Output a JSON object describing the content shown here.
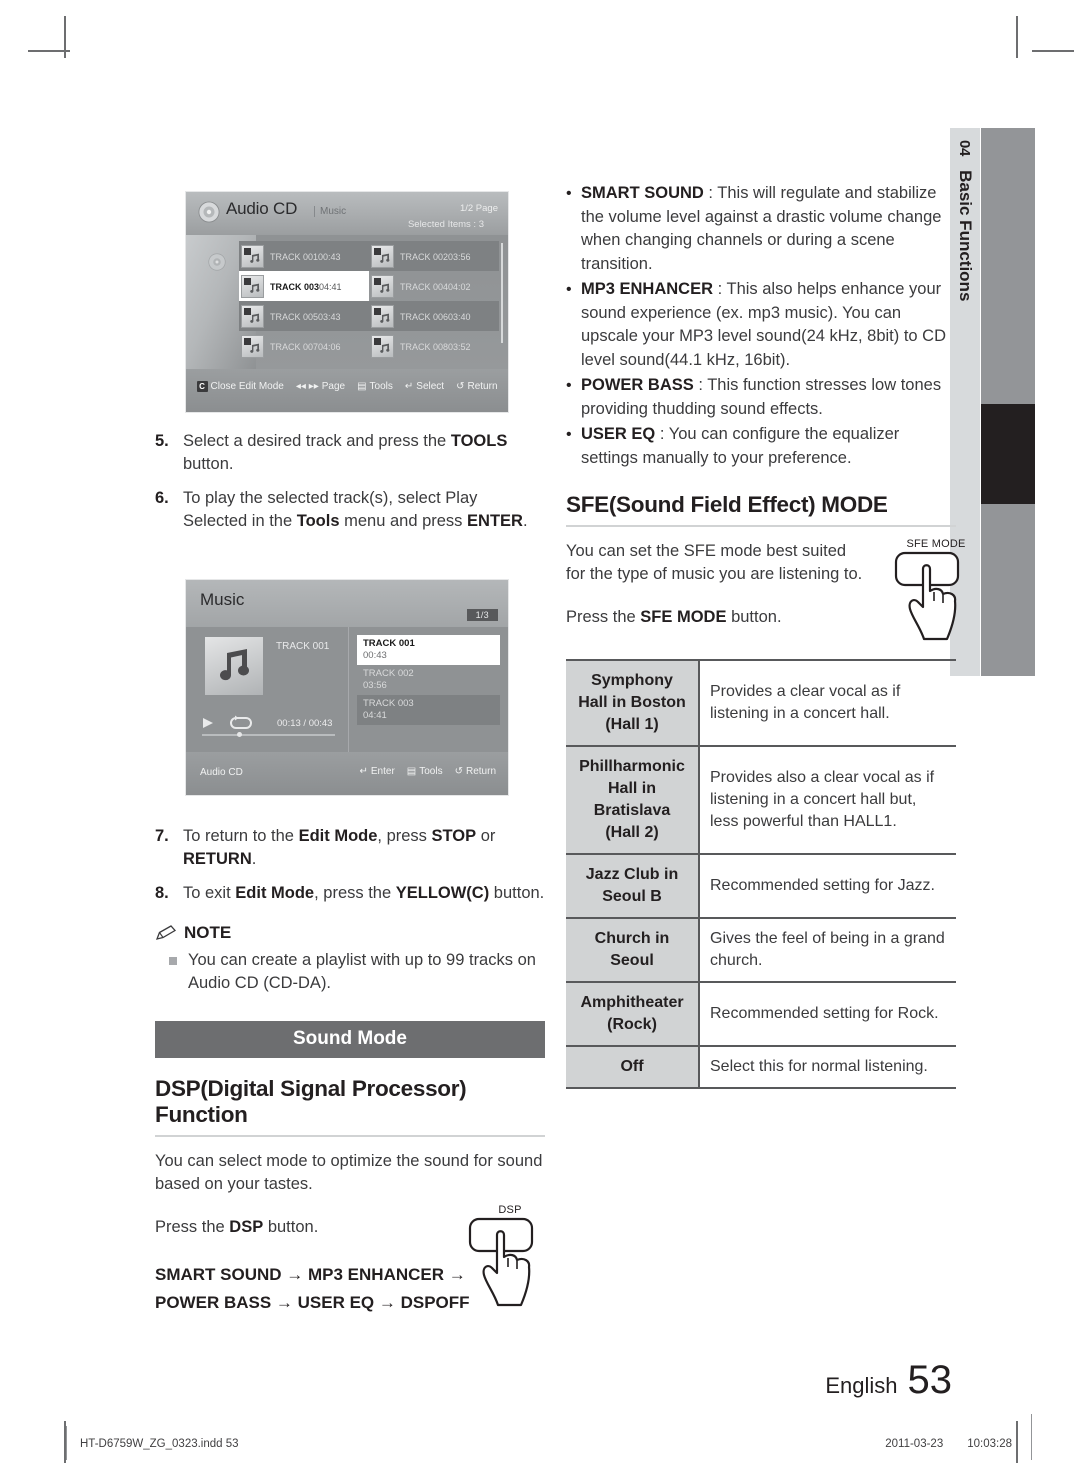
{
  "side_tab": {
    "number": "04",
    "title": "Basic Functions"
  },
  "left_column": {
    "steps": [
      {
        "n": "5.",
        "html": "Select a desired track and press the <b>TOOLS</b> button."
      },
      {
        "n": "6.",
        "html": "To play the selected track(s), select Play Selected in the <b>Tools</b> menu and press <b>ENTER</b>."
      },
      {
        "n": "7.",
        "html": "To return to the <b>Edit Mode</b>, press <b>STOP</b> or <b>RETURN</b>."
      },
      {
        "n": "8.",
        "html": "To exit <b>Edit Mode</b>, press the <b>YELLOW(C)</b> button."
      }
    ],
    "note": {
      "label": "NOTE",
      "items": [
        "You can create a playlist with up to 99 tracks on Audio CD (CD-DA)."
      ]
    },
    "banner": "Sound Mode",
    "dsp": {
      "heading": "DSP(Digital Signal Processor) Function",
      "paragraph": "You can select mode to optimize the sound for sound based on your tastes.",
      "press_html": "Press the <b>DSP</b> button.",
      "chain_line1": "SMART SOUND → MP3 ENHANCER →",
      "chain_line2": "POWER BASS →  USER EQ → DSPOFF",
      "button_caption": "DSP"
    }
  },
  "right_column": {
    "bullets": [
      {
        "html": "<b>SMART SOUND</b> : This will regulate and stabilize the volume level against a drastic volume change when changing channels or during a scene transition."
      },
      {
        "html": "<b>MP3 ENHANCER</b> : This also helps enhance your sound experience (ex. mp3 music). You can upscale your MP3 level sound(24 kHz, 8bit) to CD level sound(44.1 kHz, 16bit)."
      },
      {
        "html": "<b>POWER BASS</b> : This function stresses low tones providing thudding sound effects."
      },
      {
        "html": "<b>USER EQ</b> : You can configure the equalizer settings manually to your preference."
      }
    ],
    "sfe": {
      "heading": "SFE(Sound Field Effect) MODE",
      "paragraph": "You can set the SFE mode best suited for the type of music you are listening to.",
      "press_html": "Press the <b>SFE MODE</b> button.",
      "button_caption": "SFE MODE",
      "rows": [
        {
          "mode": "Symphony\nHall in Boston\n(Hall 1)",
          "desc": "Provides a clear vocal as if listening in a concert hall."
        },
        {
          "mode": "Phillharmonic\nHall in\nBratislava\n(Hall 2)",
          "desc": "Provides also a clear vocal as if listening in a concert hall but, less powerful than HALL1."
        },
        {
          "mode": "Jazz Club in\nSeoul B",
          "desc": "Recommended setting for Jazz."
        },
        {
          "mode": "Church in\nSeoul",
          "desc": "Gives the feel of being in a grand church."
        },
        {
          "mode": "Amphitheater\n(Rock)",
          "desc": "Recommended setting for Rock."
        },
        {
          "mode": "Off",
          "desc": "Select this for normal listening."
        }
      ]
    }
  },
  "screenshot_audio_cd": {
    "title": "Audio CD",
    "subtitle": "Music",
    "page_indicator": "1/2 Page",
    "selected_items": "Selected Items : 3",
    "tracks": [
      {
        "name": "TRACK 001",
        "time": "00:43",
        "checked": true,
        "state": "dark"
      },
      {
        "name": "TRACK 002",
        "time": "03:56",
        "checked": true,
        "state": "dark"
      },
      {
        "name": "TRACK 003",
        "time": "04:41",
        "checked": true,
        "state": "highlight"
      },
      {
        "name": "TRACK 004",
        "time": "04:02",
        "checked": false,
        "state": "normal"
      },
      {
        "name": "TRACK 005",
        "time": "03:43",
        "checked": false,
        "state": "dark"
      },
      {
        "name": "TRACK 006",
        "time": "03:40",
        "checked": false,
        "state": "dark"
      },
      {
        "name": "TRACK 007",
        "time": "04:06",
        "checked": false,
        "state": "normal"
      },
      {
        "name": "TRACK 008",
        "time": "03:52",
        "checked": false,
        "state": "normal"
      }
    ],
    "bottom_bar": {
      "key_letter": "C",
      "close_edit_mode": "Close Edit Mode",
      "page": "Page",
      "tools": "Tools",
      "select": "Select",
      "return": "Return"
    }
  },
  "screenshot_music": {
    "title": "Music",
    "page_indicator": "1/3",
    "now_playing": "TRACK 001",
    "elapsed_total": "00:13 / 00:43",
    "playlist": [
      {
        "name": "TRACK 001",
        "time": "00:43",
        "state": "highlight"
      },
      {
        "name": "TRACK 002",
        "time": "03:56",
        "state": "normal"
      },
      {
        "name": "TRACK 003",
        "time": "04:41",
        "state": "dark"
      }
    ],
    "source": "Audio CD",
    "bottom_bar": {
      "enter": "Enter",
      "tools": "Tools",
      "return": "Return"
    }
  },
  "footer": {
    "language": "English",
    "page_number": "53",
    "file_name": "HT-D6759W_ZG_0323.indd   53",
    "date": "2011-03-23",
    "time": "10:03:28"
  }
}
